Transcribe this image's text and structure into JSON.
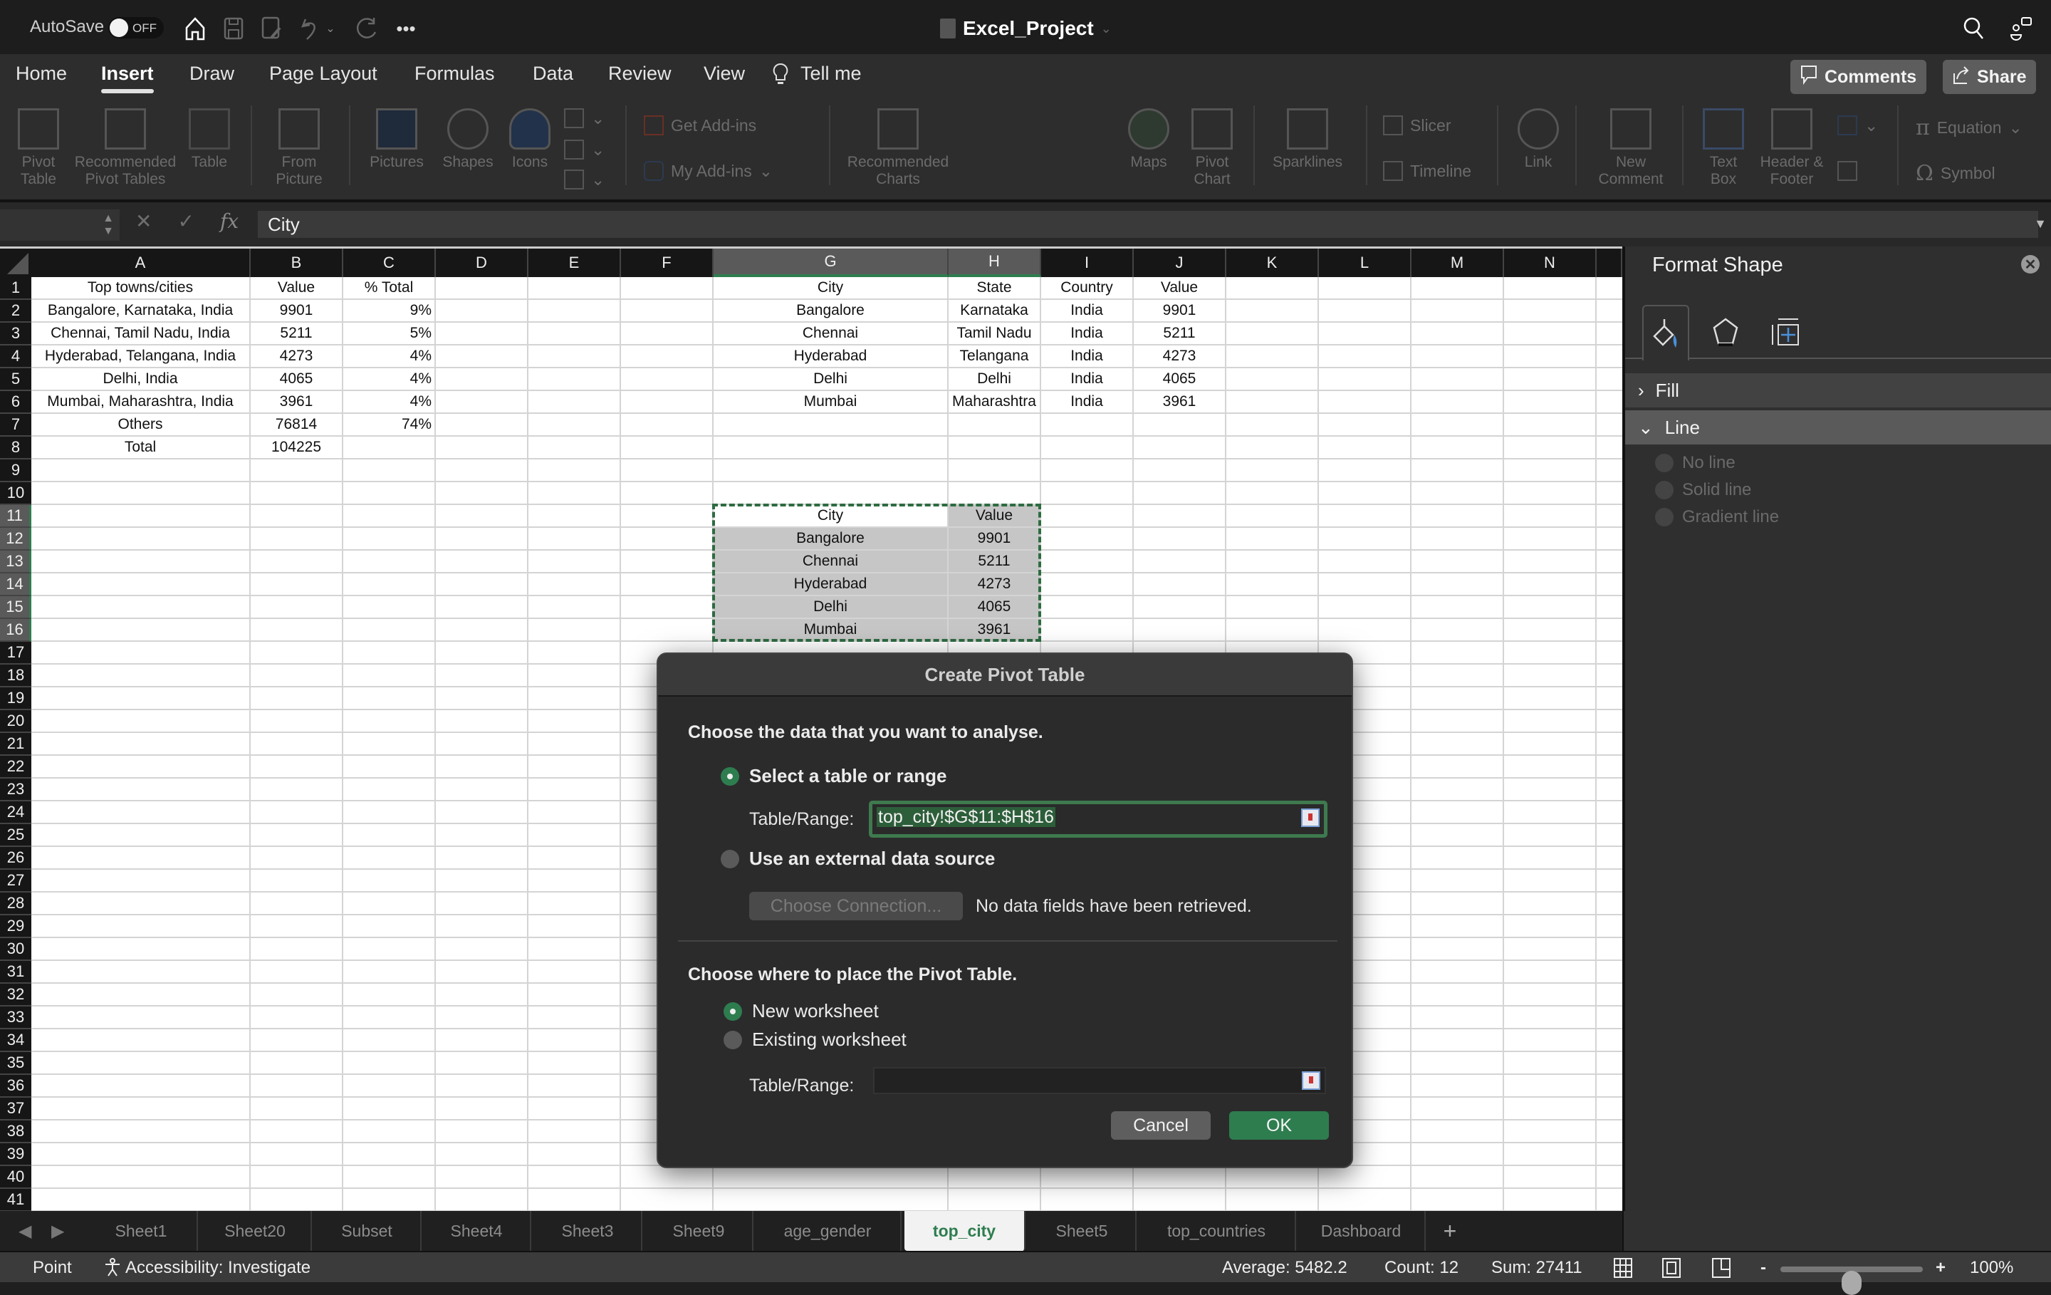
{
  "titlebar": {
    "autosave_label": "AutoSave",
    "autosave_state": "OFF",
    "doc_title": "Excel_Project",
    "icons": [
      "home-icon",
      "save-icon",
      "save-as-icon",
      "undo-icon",
      "undo-dropdown-icon",
      "redo-icon",
      "more-icon",
      "search-icon",
      "collaborate-icon"
    ]
  },
  "menu": {
    "tabs": [
      "Home",
      "Insert",
      "Draw",
      "Page Layout",
      "Formulas",
      "Data",
      "Review",
      "View"
    ],
    "active_tab": "Insert",
    "tell_me": "Tell me",
    "comments_label": "Comments",
    "share_label": "Share"
  },
  "ribbon": {
    "pivot_table": [
      "Pivot",
      "Table"
    ],
    "recommended_pivot": [
      "Recommended",
      "Pivot Tables"
    ],
    "table": "Table",
    "from_picture": [
      "From",
      "Picture"
    ],
    "pictures": "Pictures",
    "shapes": "Shapes",
    "icons": "Icons",
    "get_addins": "Get Add-ins",
    "my_addins": "My Add-ins",
    "recommended_charts": [
      "Recommended",
      "Charts"
    ],
    "maps": "Maps",
    "pivot_chart": [
      "Pivot",
      "Chart"
    ],
    "sparklines": "Sparklines",
    "slicer": "Slicer",
    "timeline": "Timeline",
    "link": "Link",
    "new_comment": [
      "New",
      "Comment"
    ],
    "text_box": [
      "Text",
      "Box"
    ],
    "header_footer": [
      "Header &",
      "Footer"
    ],
    "equation": "Equation",
    "symbol": "Symbol"
  },
  "formula_bar": {
    "name_box": "",
    "formula": "City"
  },
  "grid": {
    "columns": [
      "A",
      "B",
      "C",
      "D",
      "E",
      "F",
      "G",
      "H",
      "I",
      "J",
      "K",
      "L",
      "M",
      "N"
    ],
    "selected_columns": [
      "G",
      "H"
    ],
    "rows": [
      "1",
      "2",
      "3",
      "4",
      "5",
      "6",
      "7",
      "8",
      "9",
      "10",
      "11",
      "12",
      "13",
      "14",
      "15",
      "16",
      "17",
      "18",
      "19",
      "20",
      "21",
      "22",
      "23",
      "24",
      "25",
      "26",
      "27",
      "28",
      "29",
      "30",
      "31",
      "32",
      "33",
      "34",
      "35",
      "36",
      "37",
      "38",
      "39",
      "40",
      "41"
    ],
    "selected_rows": [
      "11",
      "12",
      "13",
      "14",
      "15",
      "16"
    ],
    "table1": {
      "headers": [
        "Top towns/cities",
        "Value",
        "% Total"
      ],
      "rows": [
        [
          "Bangalore, Karnataka, India",
          "9901",
          "9%"
        ],
        [
          "Chennai, Tamil Nadu, India",
          "5211",
          "5%"
        ],
        [
          "Hyderabad, Telangana, India",
          "4273",
          "4%"
        ],
        [
          "Delhi, India",
          "4065",
          "4%"
        ],
        [
          "Mumbai, Maharashtra, India",
          "3961",
          "4%"
        ],
        [
          "Others",
          "76814",
          "74%"
        ],
        [
          "Total",
          "104225",
          ""
        ]
      ]
    },
    "table2": {
      "headers": [
        "City",
        "State",
        "Country",
        "Value"
      ],
      "rows": [
        [
          "Bangalore",
          "Karnataka",
          "India",
          "9901"
        ],
        [
          "Chennai",
          "Tamil Nadu",
          "India",
          "5211"
        ],
        [
          "Hyderabad",
          "Telangana",
          "India",
          "4273"
        ],
        [
          "Delhi",
          "Delhi",
          "India",
          "4065"
        ],
        [
          "Mumbai",
          "Maharashtra",
          "India",
          "3961"
        ]
      ]
    },
    "table3": {
      "headers": [
        "City",
        "Value"
      ],
      "rows": [
        [
          "Bangalore",
          "9901"
        ],
        [
          "Chennai",
          "5211"
        ],
        [
          "Hyderabad",
          "4273"
        ],
        [
          "Delhi",
          "4065"
        ],
        [
          "Mumbai",
          "3961"
        ]
      ]
    }
  },
  "format_panel": {
    "title": "Format Shape",
    "tabs": [
      "fill-line-icon",
      "effects-icon",
      "size-properties-icon"
    ],
    "sections": [
      {
        "label": "Fill",
        "expanded": false
      },
      {
        "label": "Line",
        "expanded": true
      }
    ],
    "line_options": [
      "No line",
      "Solid line",
      "Gradient line"
    ]
  },
  "dialog": {
    "title": "Create Pivot Table",
    "section1_heading": "Choose the data that you want to analyse.",
    "option_range": "Select a table or range",
    "range_label": "Table/Range:",
    "range_value": "top_city!$G$11:$H$16",
    "option_external": "Use an external data source",
    "choose_connection": "Choose Connection...",
    "no_fields": "No data fields have been retrieved.",
    "section2_heading": "Choose where to place the Pivot Table.",
    "option_new": "New worksheet",
    "option_existing": "Existing worksheet",
    "dest_label": "Table/Range:",
    "dest_value": "",
    "cancel": "Cancel",
    "ok": "OK",
    "selected_source": "Select a table or range",
    "selected_destination": "New worksheet"
  },
  "sheets": {
    "tabs": [
      "Sheet1",
      "Sheet20",
      "Subset",
      "Sheet4",
      "Sheet3",
      "Sheet9",
      "age_gender",
      "top_city",
      "Sheet5",
      "top_countries",
      "Dashboard"
    ],
    "active": "top_city",
    "add_label": "+"
  },
  "status": {
    "mode": "Point",
    "accessibility": "Accessibility: Investigate",
    "average": "Average: 5482.2",
    "count": "Count: 12",
    "sum": "Sum: 27411",
    "zoom": "100%",
    "zoom_minus": "-",
    "zoom_plus": "+",
    "zoom_fraction": 0.5
  },
  "colors": {
    "accent_green": "#2e7d4f",
    "selection_fill": "#c6c6c6",
    "dialog_bg": "#2b2b2c"
  }
}
